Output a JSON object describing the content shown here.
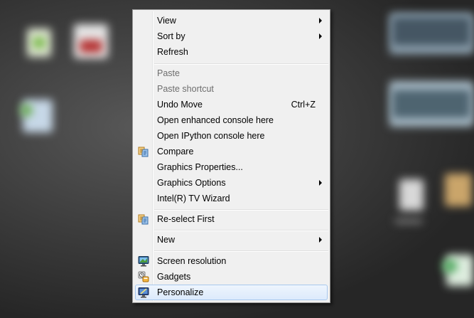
{
  "menu": {
    "items": [
      {
        "label": "View",
        "submenu": true
      },
      {
        "label": "Sort by",
        "submenu": true
      },
      {
        "label": "Refresh"
      },
      {
        "label": "Paste",
        "disabled": true
      },
      {
        "label": "Paste shortcut",
        "disabled": true
      },
      {
        "label": "Undo Move",
        "shortcut": "Ctrl+Z"
      },
      {
        "label": "Open enhanced console here"
      },
      {
        "label": "Open IPython console here"
      },
      {
        "label": "Compare",
        "icon": "compare-icon"
      },
      {
        "label": "Graphics Properties..."
      },
      {
        "label": "Graphics Options",
        "submenu": true
      },
      {
        "label": "Intel(R) TV Wizard"
      },
      {
        "label": "Re-select First",
        "icon": "compare-icon"
      },
      {
        "label": "New",
        "submenu": true
      },
      {
        "label": "Screen resolution",
        "icon": "monitor-icon"
      },
      {
        "label": "Gadgets",
        "icon": "gadgets-icon"
      },
      {
        "label": "Personalize",
        "icon": "personalize-icon",
        "highlighted": true
      }
    ]
  },
  "colors": {
    "menu_bg": "#f0f0f0",
    "highlight": "#dceafc",
    "disabled_text": "#6d6d6d"
  }
}
